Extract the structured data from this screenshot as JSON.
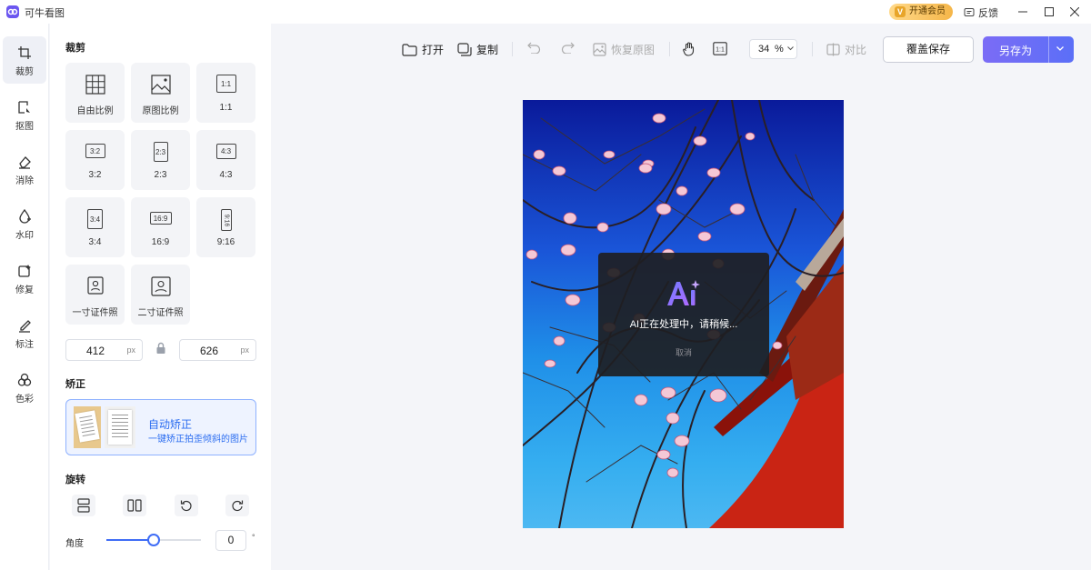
{
  "app": {
    "title": "可牛看图"
  },
  "titlebar": {
    "vip_label": "开通会员",
    "vip_glyph": "V",
    "feedback_label": "反馈"
  },
  "rail": {
    "items": [
      {
        "label": "裁剪",
        "icon": "crop-icon"
      },
      {
        "label": "抠图",
        "icon": "cutout-icon"
      },
      {
        "label": "消除",
        "icon": "eraser-icon"
      },
      {
        "label": "水印",
        "icon": "watermark-icon"
      },
      {
        "label": "修复",
        "icon": "repair-icon"
      },
      {
        "label": "标注",
        "icon": "annotate-icon"
      },
      {
        "label": "色彩",
        "icon": "color-icon"
      }
    ]
  },
  "crop": {
    "title": "裁剪",
    "options": [
      {
        "label": "自由比例",
        "glyph": ""
      },
      {
        "label": "原图比例",
        "glyph": ""
      },
      {
        "label": "1:1",
        "glyph": "1:1"
      },
      {
        "label": "3:2",
        "glyph": "3:2"
      },
      {
        "label": "2:3",
        "glyph": "2:3"
      },
      {
        "label": "4:3",
        "glyph": "4:3"
      },
      {
        "label": "3:4",
        "glyph": "3:4"
      },
      {
        "label": "16:9",
        "glyph": "16:9"
      },
      {
        "label": "9:16",
        "glyph": "9:16"
      },
      {
        "label": "一寸证件照",
        "glyph": ""
      },
      {
        "label": "二寸证件照",
        "glyph": ""
      }
    ],
    "width_value": "412",
    "height_value": "626",
    "unit": "px"
  },
  "correct": {
    "title": "矫正",
    "auto_title": "自动矫正",
    "auto_desc": "一键矫正拍歪倾斜的图片"
  },
  "rotate": {
    "title": "旋转",
    "angle_label": "角度",
    "angle_value": "0",
    "angle_unit": "°",
    "slider_level": 0.5
  },
  "toolbar": {
    "open": "打开",
    "copy": "复制",
    "restore": "恢复原图",
    "zoom_value": "34",
    "zoom_unit": "%",
    "compare": "对比",
    "overwrite_save": "覆盖保存",
    "save_as": "另存为"
  },
  "overlay": {
    "logo_text": "Ai",
    "message": "AI正在处理中，请稍候...",
    "cancel": "取消"
  },
  "colors": {
    "accent": "#3f6df6",
    "save_as": "#6b6ef6",
    "vip": "#f5b649"
  }
}
